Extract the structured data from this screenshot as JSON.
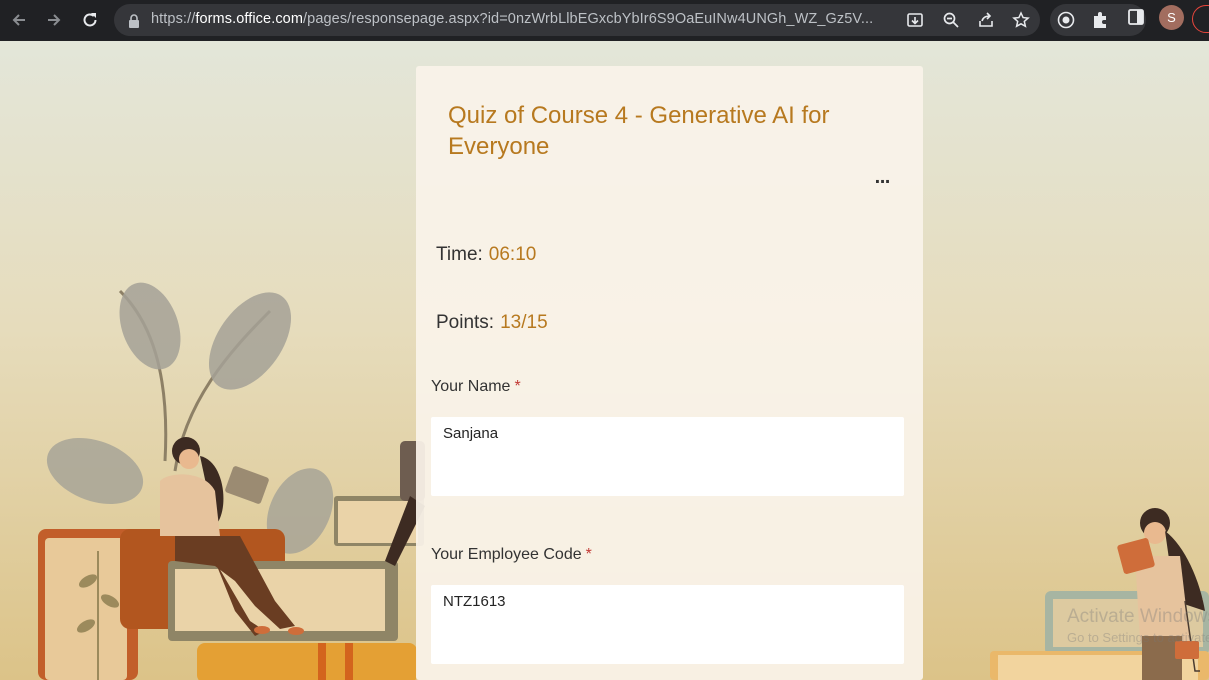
{
  "browser": {
    "url_prefix": "https://",
    "url_host": "forms.office.com",
    "url_rest": "/pages/responsepage.aspx?id=0nzWrbLlbEGxcbYbIr6S9OaEuINw4UNGh_WZ_Gz5V...",
    "profile_initial": "S"
  },
  "form": {
    "title": "Quiz of Course 4 - Generative AI for Everyone",
    "more_label": "...",
    "time_label": "Time:",
    "time_value": "06:10",
    "points_label": "Points:",
    "points_value": "13/15",
    "required_mark": "*",
    "fields": [
      {
        "label": "Your Name",
        "value": "Sanjana"
      },
      {
        "label": "Your Employee Code",
        "value": "NTZ1613"
      }
    ]
  },
  "watermark": {
    "line1": "Activate Windows",
    "line2": "Go to Settings to activate Windows."
  },
  "colors": {
    "accent": "#b7791f",
    "required": "#c23934",
    "chrome_bg": "#202124"
  }
}
